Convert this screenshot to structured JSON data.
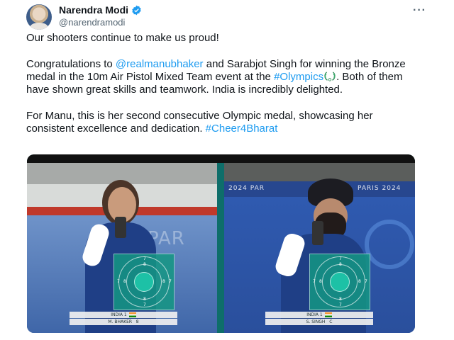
{
  "author": {
    "display_name": "Narendra Modi",
    "handle": "@narendramodi",
    "verified": true
  },
  "tweet": {
    "para1": "Our shooters continue to make us proud!",
    "para2_prefix": "Congratulations to ",
    "mention": "@realmanubhaker",
    "para2_mid": " and Sarabjot Singh for winning the Bronze medal in the 10m Air Pistol Mixed Team event at the ",
    "hashtag_olympics": "#Olympics",
    "para2_suffix": ". Both of them have shown great skills and teamwork. India is incredibly delighted.",
    "para3_prefix": "For Manu, this is her second consecutive Olympic medal, showcasing her consistent excellence and dedication. ",
    "hashtag_cheer": "#Cheer4Bharat"
  },
  "media": {
    "left": {
      "score_team": "INDIA 1",
      "score_name": "M. BHAKER",
      "score_extra": "8",
      "banner": "PAR"
    },
    "right": {
      "score_team": "INDIA 1",
      "score_name": "S. SINGH",
      "score_extra": "C",
      "banner_left": "2024 PAR",
      "banner_right": "PARIS 2024"
    },
    "ring_numbers": [
      "7",
      "8",
      "7",
      "8",
      "8",
      "7",
      "8",
      "7"
    ]
  },
  "colors": {
    "link": "#1d9bf0",
    "verified": "#1d9bf0",
    "target": "#149682"
  },
  "icons": {
    "more": "more-horizontal-icon",
    "verified": "verified-badge-icon",
    "olympics": "laurel-wreath-icon"
  }
}
